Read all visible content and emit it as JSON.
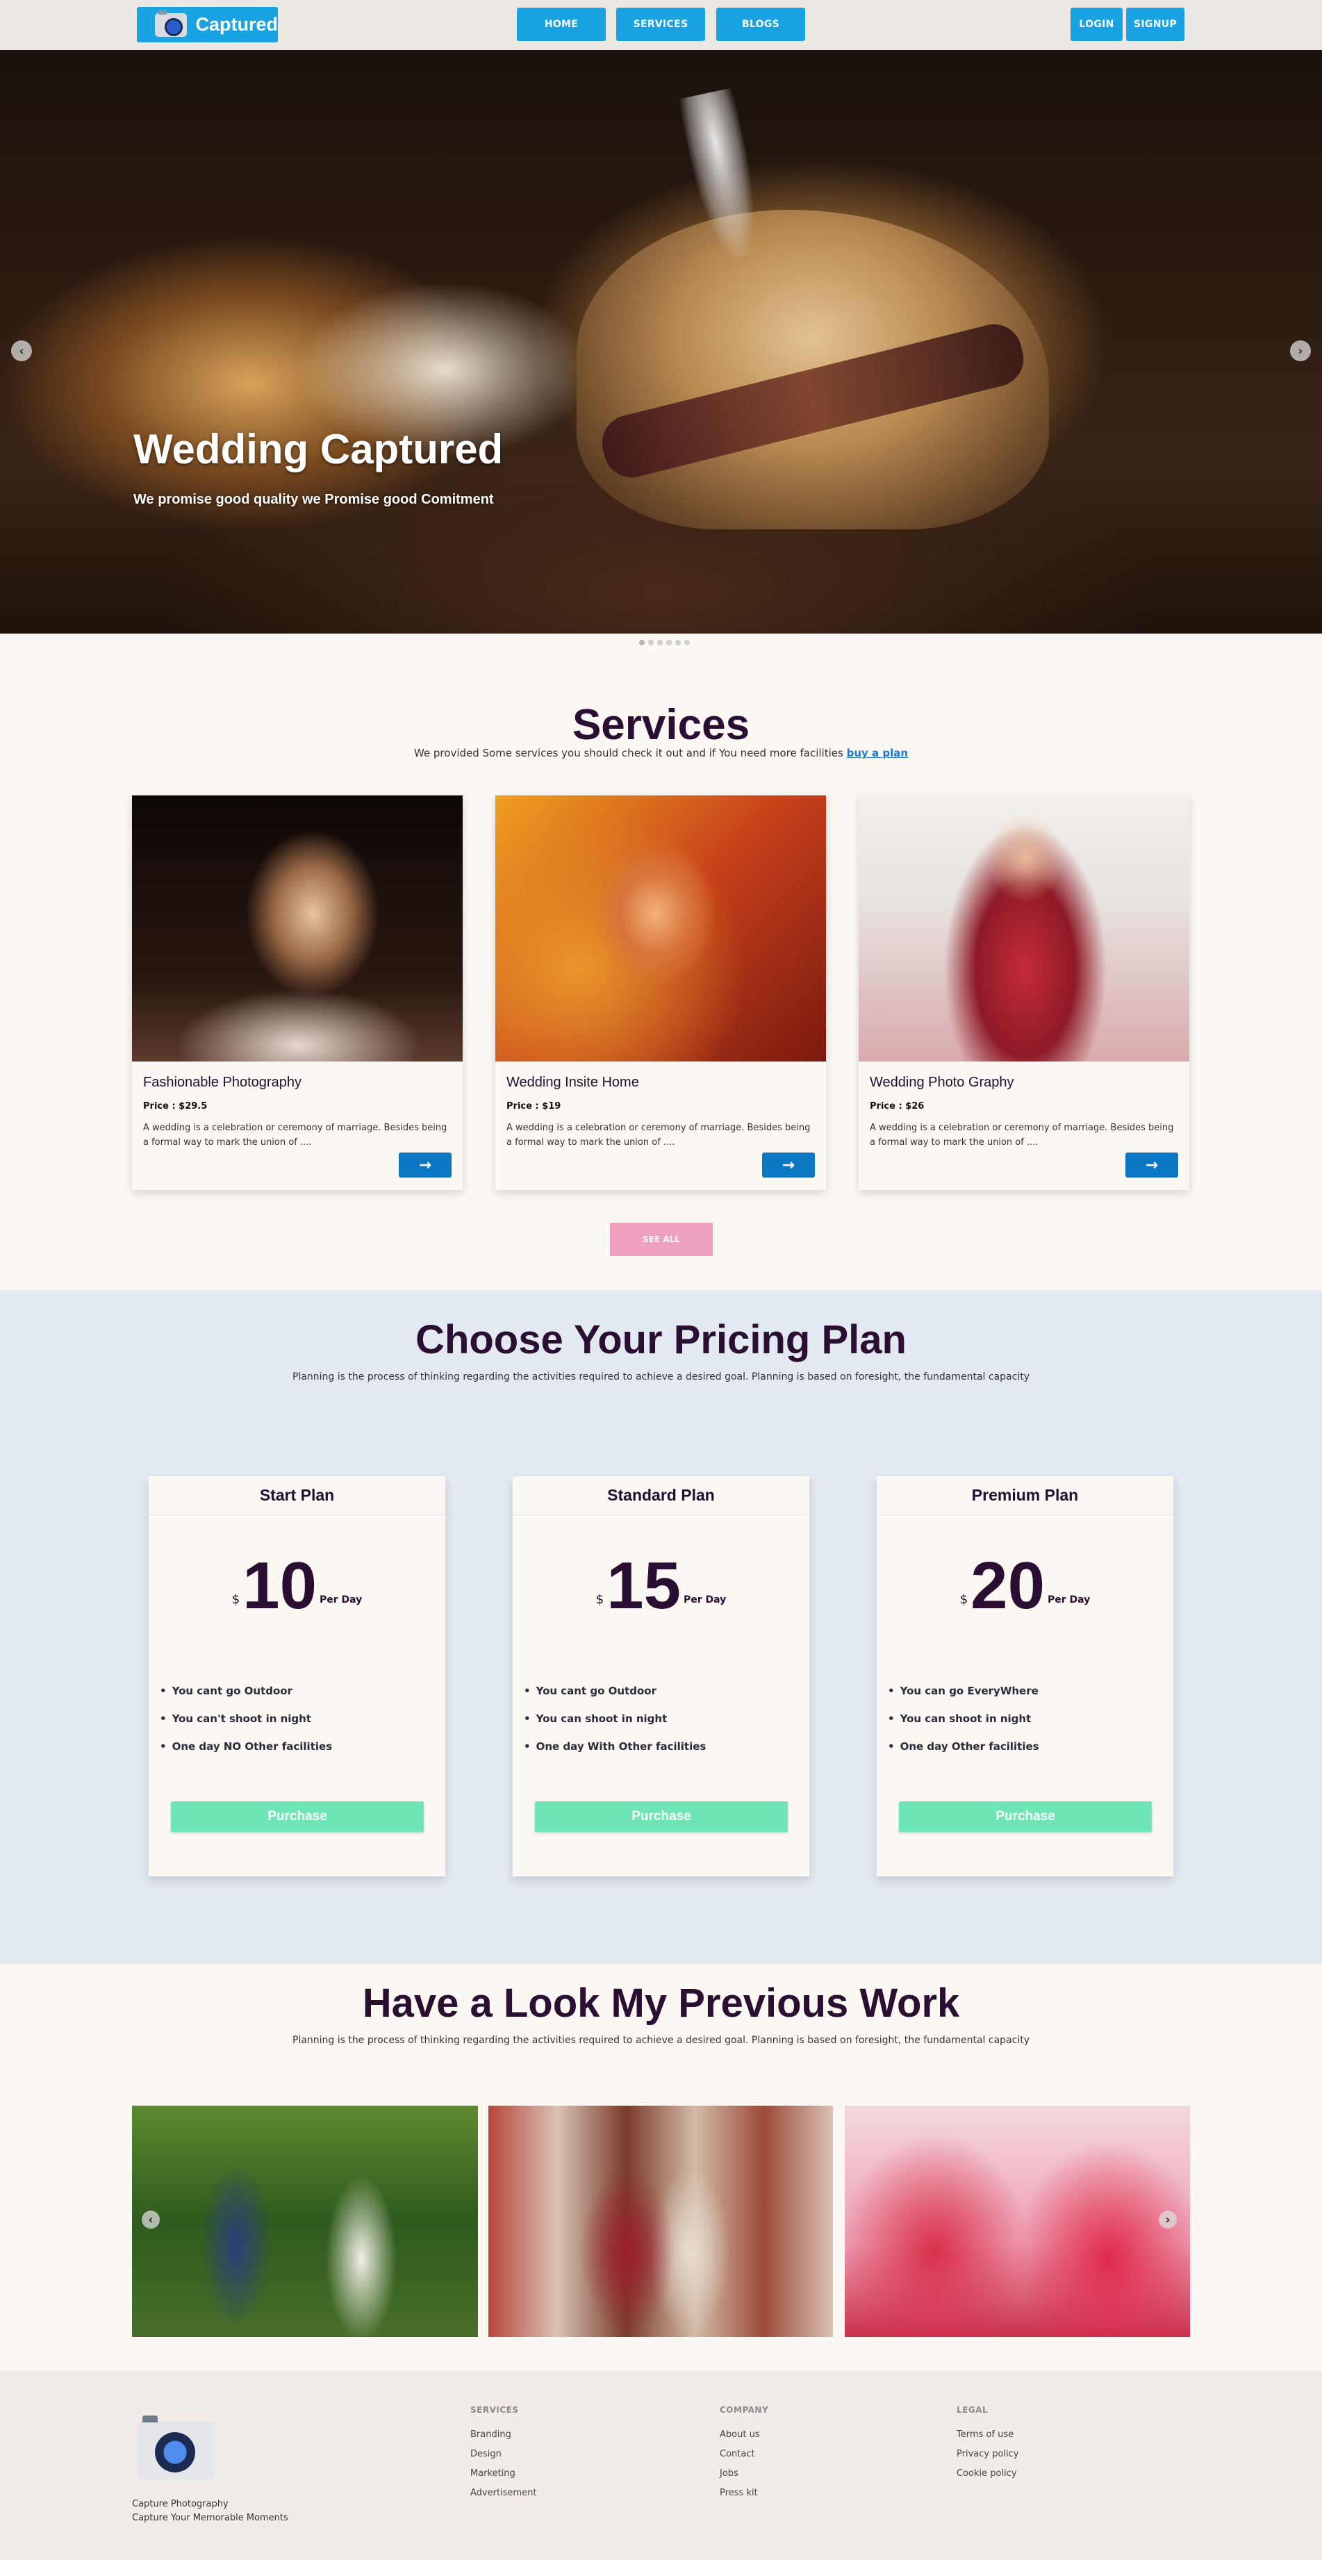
{
  "nav": {
    "logo_text": "Captured",
    "links": [
      "HOME",
      "SERVICES",
      "BLOGS"
    ],
    "login": "LOGIN",
    "signup": "SIGNUP"
  },
  "hero": {
    "title": "Wedding Captured",
    "subtitle": "We promise good quality we Promise good Comitment",
    "prev_icon": "chevron-left-icon",
    "next_icon": "chevron-right-icon",
    "slide_count": 6,
    "active_slide": 1
  },
  "services": {
    "title": "Services",
    "subtitle": "We provided Some services you should check it out and if You need more facilities",
    "subtitle_link": "buy a plan",
    "cards": [
      {
        "name": "Fashionable Photography",
        "price": "Price : $29.5",
        "desc": "A wedding is a celebration or ceremony of marriage. Besides being a formal way to mark the union of ...."
      },
      {
        "name": "Wedding Insite Home",
        "price": "Price : $19",
        "desc": "A wedding is a celebration or ceremony of marriage. Besides being a formal way to mark the union of ...."
      },
      {
        "name": "Wedding Photo Graphy",
        "price": "Price : $26",
        "desc": "A wedding is a celebration or ceremony of marriage. Besides being a formal way to mark the union of ...."
      }
    ],
    "see_all": "SEE ALL"
  },
  "pricing": {
    "title": "Choose Your Pricing Plan",
    "subtitle": "Planning is the process of thinking regarding the activities required to achieve a desired goal. Planning is based on foresight, the fundamental capacity",
    "plans": [
      {
        "name": "Start Plan",
        "currency": "$",
        "amount": "10",
        "period": "Per Day",
        "features": [
          "You cant go Outdoor",
          "You can't shoot in night",
          "One day NO Other facilities"
        ],
        "button": "Purchase"
      },
      {
        "name": "Standard Plan",
        "currency": "$",
        "amount": "15",
        "period": "Per Day",
        "features": [
          "You cant go Outdoor",
          "You can shoot in night",
          "One day With Other facilities"
        ],
        "button": "Purchase"
      },
      {
        "name": "Premium Plan",
        "currency": "$",
        "amount": "20",
        "period": "Per Day",
        "features": [
          "You can go EveryWhere",
          "You can shoot in night",
          "One day Other facilities"
        ],
        "button": "Purchase"
      }
    ]
  },
  "portfolio": {
    "title": "Have a Look My Previous Work",
    "subtitle": "Planning is the process of thinking regarding the activities required to achieve a desired goal. Planning is based on foresight, the fundamental capacity"
  },
  "footer": {
    "tagline1": "Capture Photography",
    "tagline2": "Capture Your Memorable Moments",
    "columns": [
      {
        "heading": "SERVICES",
        "links": [
          "Branding",
          "Design",
          "Marketing",
          "Advertisement"
        ]
      },
      {
        "heading": "COMPANY",
        "links": [
          "About us",
          "Contact",
          "Jobs",
          "Press kit"
        ]
      },
      {
        "heading": "LEGAL",
        "links": [
          "Terms of use",
          "Privacy policy",
          "Cookie policy"
        ]
      }
    ]
  },
  "colors": {
    "primary": "#1aa3e2",
    "card_button": "#0b77c5",
    "see_all": "#ef9fbf",
    "purchase": "#6ee5b4",
    "heading": "#2a0f33",
    "pricing_bg": "#e3e9f1"
  }
}
